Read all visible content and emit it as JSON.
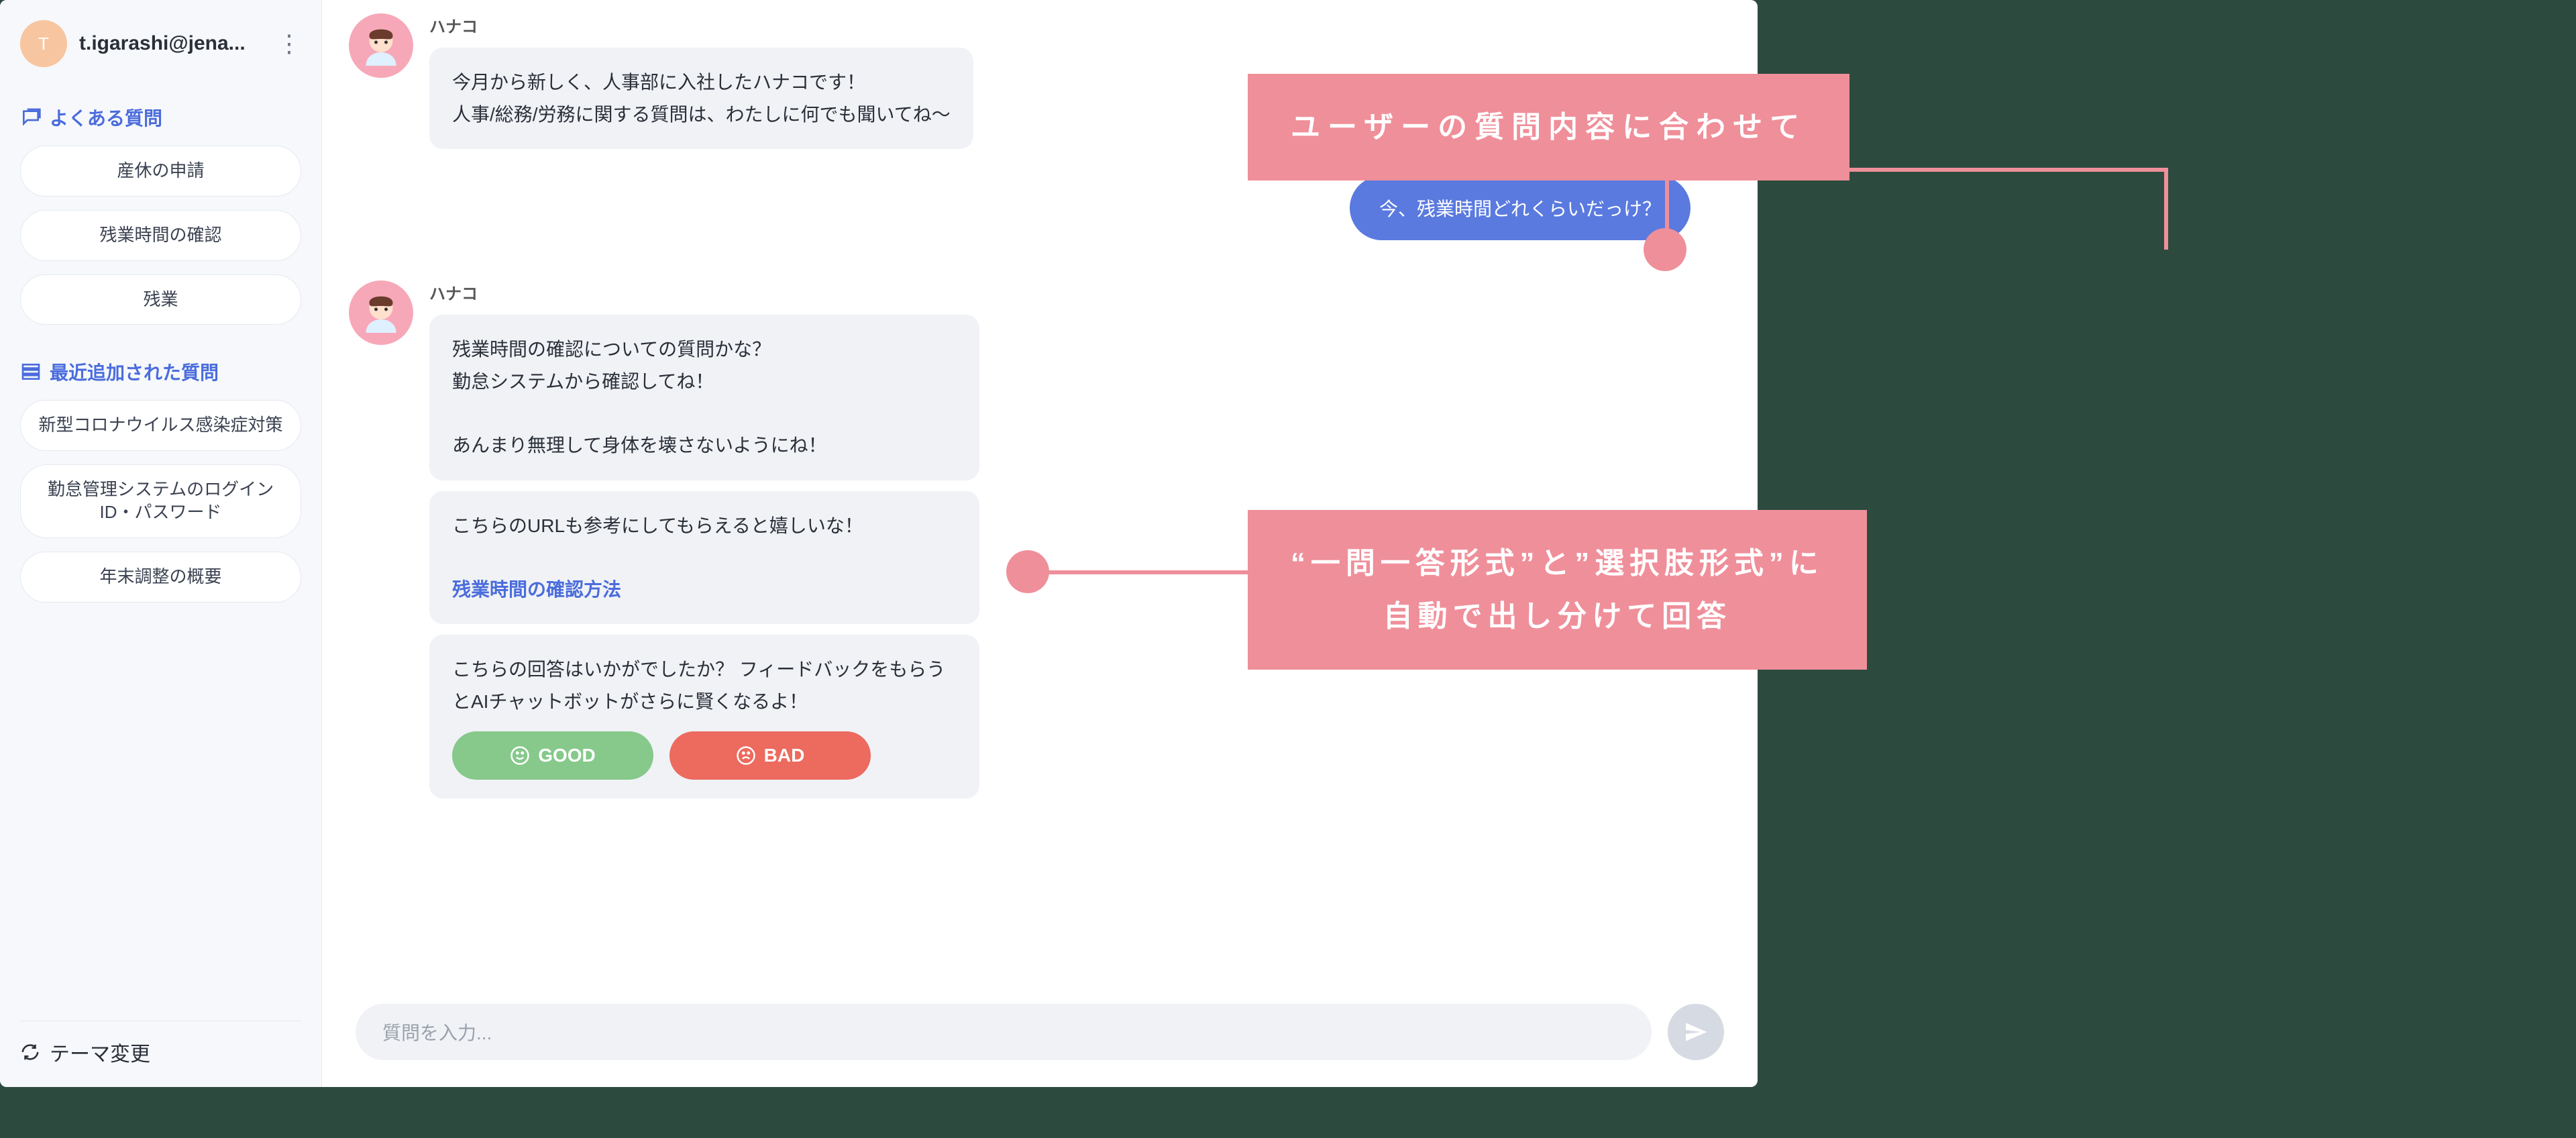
{
  "profile": {
    "avatar_letter": "T",
    "username": "t.igarashi@jena..."
  },
  "sidebar": {
    "faq_header": "よくある質問",
    "faq_items": [
      "産休の申請",
      "残業時間の確認",
      "残業"
    ],
    "recent_header": "最近追加された質問",
    "recent_items": [
      "新型コロナウイルス感染症対策",
      "勤怠管理システムのログインID・パスワード",
      "年末調整の概要"
    ],
    "theme_label": "テーマ変更"
  },
  "chat": {
    "bot_name": "ハナコ",
    "intro": "今月から新しく、人事部に入社したハナコです！\n人事/総務/労務に関する質問は、わたしに何でも聞いてね〜",
    "user_msg": "今、残業時間どれくらいだっけ？",
    "answer1": "残業時間の確認についての質問かな？\n勤怠システムから確認してね！\n\nあんまり無理して身体を壊さないようにね！",
    "answer2_prefix": "こちらのURLも参考にしてもらえると嬉しいな！",
    "answer2_link": "残業時間の確認方法",
    "feedback_prompt": "こちらの回答はいかがでしたか？ フィードバックをもらうとAIチャットボットがさらに賢くなるよ！",
    "good_label": "GOOD",
    "bad_label": "BAD",
    "input_placeholder": "質問を入力..."
  },
  "callouts": {
    "c1": "ユーザーの質問内容に合わせて",
    "c2_line1": "“一問一答形式”と”選択肢形式”に",
    "c2_line2": "自動で出し分けて回答"
  }
}
